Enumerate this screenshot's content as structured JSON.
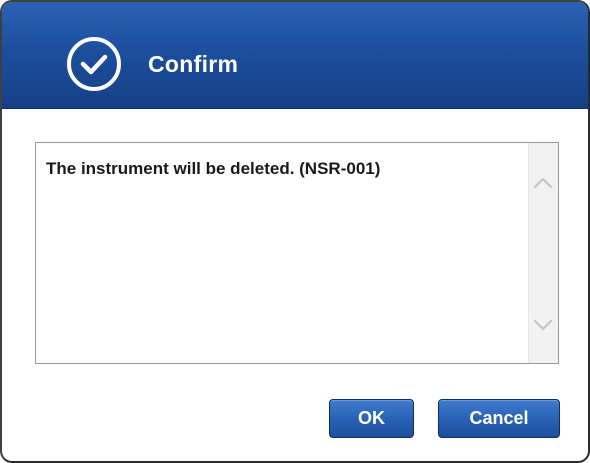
{
  "dialog": {
    "title": "Confirm",
    "title_icon": "check-circle-icon",
    "message": "The instrument will be deleted. (NSR-001)"
  },
  "buttons": {
    "ok_label": "OK",
    "cancel_label": "Cancel"
  },
  "scrollbar": {
    "up_icon": "chevron-up-icon",
    "down_icon": "chevron-down-icon"
  },
  "colors": {
    "title_bar": "#1d4f9e",
    "button": "#2a63b5",
    "text": "#1a1a1a"
  }
}
